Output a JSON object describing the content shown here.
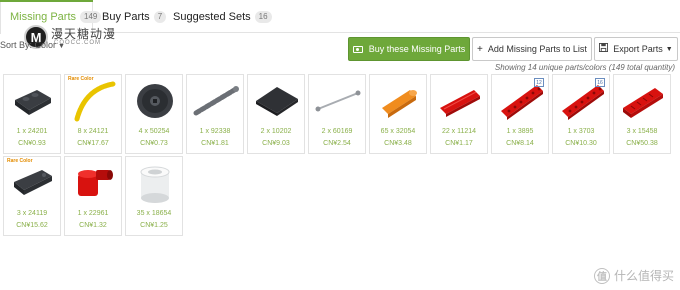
{
  "tabs": [
    {
      "label": "Missing Parts",
      "count": "149"
    },
    {
      "label": "Buy Parts",
      "count": "7"
    },
    {
      "label": "Suggested Sets",
      "count": "16"
    }
  ],
  "watermark": {
    "badge": "M",
    "cn_text": "漫天糖动漫",
    "url": "COOCC.COM"
  },
  "sort": {
    "label": "Sort By:",
    "value": "Color"
  },
  "toolbar": {
    "buy_label": "Buy these Missing Parts",
    "add_label": "Add Missing Parts to List",
    "export_label": "Export Parts"
  },
  "summary": "Showing 14 unique parts/colors (149 total quantity)",
  "parts": [
    {
      "qty": "1 x 24201",
      "price": "CN¥0.93",
      "icon": "dark-slope-plate",
      "rare": false,
      "num": ""
    },
    {
      "qty": "8 x 24121",
      "price": "CN¥17.67",
      "icon": "yellow-flex-tube",
      "rare": true,
      "num": ""
    },
    {
      "qty": "4 x 50254",
      "price": "CN¥0.73",
      "icon": "dark-wheel",
      "rare": false,
      "num": ""
    },
    {
      "qty": "1 x 92338",
      "price": "CN¥1.81",
      "icon": "gray-chain",
      "rare": false,
      "num": ""
    },
    {
      "qty": "2 x 10202",
      "price": "CN¥9.03",
      "icon": "dark-tile-6x6",
      "rare": false,
      "num": ""
    },
    {
      "qty": "2 x 60169",
      "price": "CN¥2.54",
      "icon": "gray-chain-link",
      "rare": false,
      "num": ""
    },
    {
      "qty": "65 x 32054",
      "price": "CN¥3.48",
      "icon": "orange-pin",
      "rare": false,
      "num": ""
    },
    {
      "qty": "22 x 11214",
      "price": "CN¥1.17",
      "icon": "red-axle-pin",
      "rare": false,
      "num": ""
    },
    {
      "qty": "1 x 3895",
      "price": "CN¥8.14",
      "icon": "red-technic-beam",
      "rare": false,
      "num": "12"
    },
    {
      "qty": "1 x 3703",
      "price": "CN¥10.30",
      "icon": "red-technic-beam",
      "rare": false,
      "num": "16"
    },
    {
      "qty": "3 x 15458",
      "price": "CN¥50.38",
      "icon": "red-panel",
      "rare": false,
      "num": ""
    },
    {
      "qty": "3 x 24119",
      "price": "CN¥15.62",
      "icon": "dark-slope-brick",
      "rare": true,
      "num": ""
    },
    {
      "qty": "1 x 22961",
      "price": "CN¥1.32",
      "icon": "red-axle-connector",
      "rare": false,
      "num": ""
    },
    {
      "qty": "35 x 18654",
      "price": "CN¥1.25",
      "icon": "white-round-beam",
      "rare": false,
      "num": ""
    }
  ],
  "rare_label": "Rare Color",
  "footer_watermark": {
    "badge": "值",
    "text": "什么值得买"
  },
  "colors": {
    "accent": "#6ea83a",
    "price": "#8ab04a"
  }
}
